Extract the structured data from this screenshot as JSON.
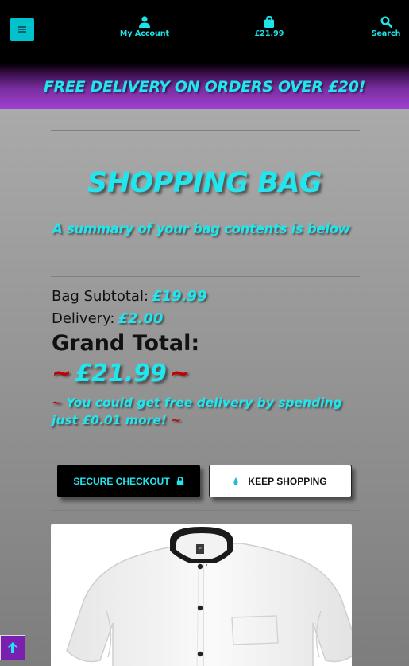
{
  "header": {
    "account_label": "My Account",
    "bag_total": "£21.99",
    "search_label": "Search"
  },
  "promo": {
    "text": "FREE DELIVERY ON ORDERS OVER £20!"
  },
  "page": {
    "title": "SHOPPING BAG",
    "subtitle": "A summary of your bag contents is below"
  },
  "summary": {
    "subtotal_label": "Bag Subtotal:",
    "subtotal_value": "£19.99",
    "delivery_label": "Delivery:",
    "delivery_value": "£2.00",
    "grand_label": "Grand Total:",
    "grand_value": "£21.99",
    "tilde": "~",
    "free_delivery_msg": "You could get free delivery by spending just £0.01 more!"
  },
  "buttons": {
    "checkout_label": "SECURE CHECKOUT",
    "keep_shopping_label": "KEEP SHOPPING"
  },
  "colors": {
    "accent": "#22e6ee",
    "promo_purple": "#9f3fd0",
    "tilde_red": "#c20000"
  },
  "icons": {
    "menu": "hamburger-menu-icon",
    "account": "user-icon",
    "bag": "shopping-bag-icon",
    "search": "search-icon",
    "lock": "lock-icon",
    "back_to_top": "arrow-up-icon"
  }
}
